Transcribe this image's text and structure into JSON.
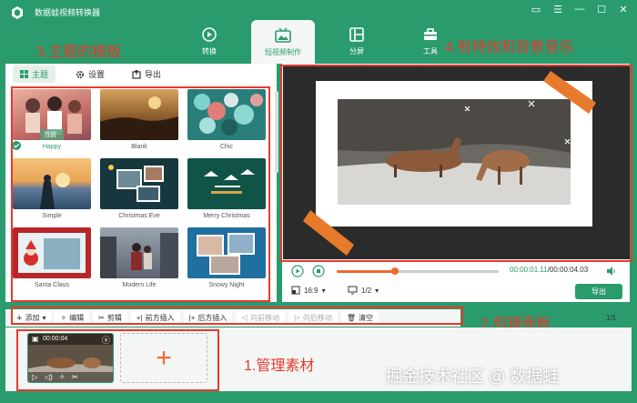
{
  "app": {
    "title": "数据蛙视频转换器"
  },
  "nav": [
    {
      "label": "转换",
      "icon": "convert-icon"
    },
    {
      "label": "短视频制作",
      "icon": "short-video-icon",
      "active": true
    },
    {
      "label": "分屏",
      "icon": "split-screen-icon"
    },
    {
      "label": "工具",
      "icon": "toolbox-icon"
    }
  ],
  "annotations": {
    "note1": "1.管理素材",
    "note2": "2.剪辑面板",
    "note3": "3.主题的模板",
    "note4": "4.有特效和背景音乐"
  },
  "left_tabs": [
    {
      "label": "主题",
      "icon": "grid-icon",
      "active": true
    },
    {
      "label": "设置",
      "icon": "gear-icon"
    },
    {
      "label": "导出",
      "icon": "export-icon"
    }
  ],
  "themes": [
    {
      "label": "Happy",
      "active": true,
      "badge": "当前"
    },
    {
      "label": "Blank"
    },
    {
      "label": "Chic"
    },
    {
      "label": "Simple"
    },
    {
      "label": "Christmas Eve"
    },
    {
      "label": "Merry Christmas"
    },
    {
      "label": "Santa Claus"
    },
    {
      "label": "Modern Life"
    },
    {
      "label": "Snowy Night"
    }
  ],
  "player": {
    "time_current": "00:00:01.11",
    "time_total": "/00:00:04.03",
    "progress": 0.36,
    "ratio": "16:9",
    "page": "1/2",
    "export_label": "导出"
  },
  "toolbar": [
    {
      "label": "添加",
      "icon": "plus-icon",
      "dropdown": true
    },
    {
      "label": "编辑",
      "icon": "magic-wand-icon"
    },
    {
      "label": "剪辑",
      "icon": "scissors-icon"
    },
    {
      "label": "前方插入",
      "icon": "insert-before-icon"
    },
    {
      "label": "后方插入",
      "icon": "insert-after-icon"
    },
    {
      "label": "向前移动",
      "icon": "move-forward-icon",
      "disabled": true
    },
    {
      "label": "向后移动",
      "icon": "move-backward-icon",
      "disabled": true
    },
    {
      "label": "清空",
      "icon": "trash-icon"
    }
  ],
  "page_count": "1/1",
  "clip": {
    "duration": "00:00:04"
  },
  "add_slot": "+",
  "watermark": "掘金技术社区 @ 数据蛙",
  "colors": {
    "brand": "#2a9b6c",
    "accent": "#f06a2c",
    "annotation": "#e8392f"
  }
}
